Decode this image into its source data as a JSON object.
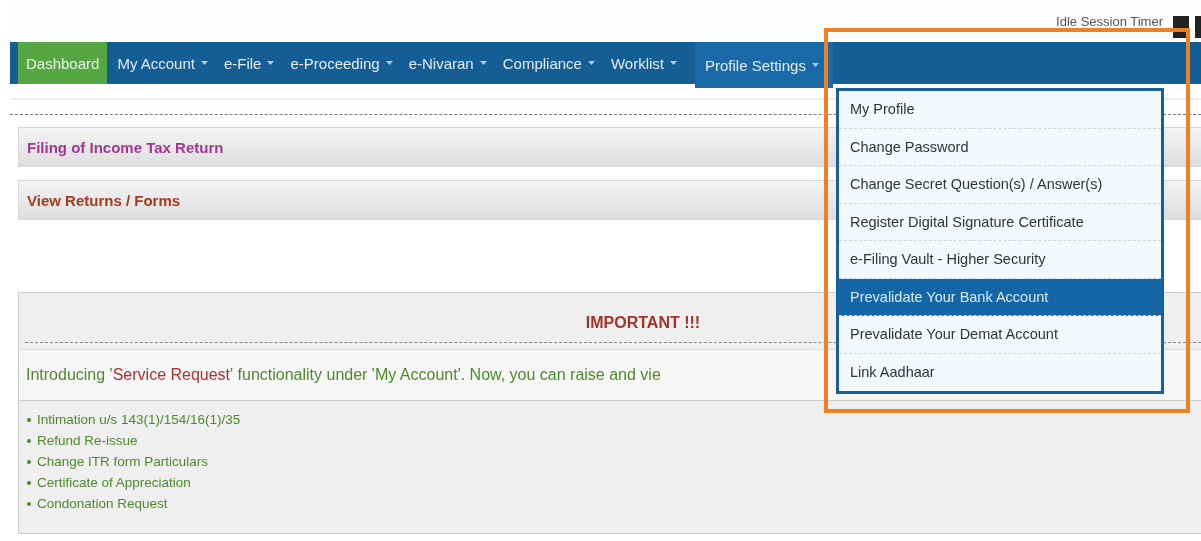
{
  "header": {
    "timer_label": "Idle Session Timer"
  },
  "nav": [
    {
      "label": "Dashboard",
      "selected": true,
      "has_menu": false,
      "open": false
    },
    {
      "label": "My Account",
      "selected": false,
      "has_menu": true,
      "open": false
    },
    {
      "label": "e-File",
      "selected": false,
      "has_menu": true,
      "open": false
    },
    {
      "label": "e-Proceeding",
      "selected": false,
      "has_menu": true,
      "open": false
    },
    {
      "label": "e-Nivaran",
      "selected": false,
      "has_menu": true,
      "open": false
    },
    {
      "label": "Compliance",
      "selected": false,
      "has_menu": true,
      "open": false
    },
    {
      "label": "Worklist",
      "selected": false,
      "has_menu": true,
      "open": false
    },
    {
      "label": "Profile Settings",
      "selected": false,
      "has_menu": true,
      "open": true
    }
  ],
  "dropdown": [
    {
      "label": "My Profile",
      "selected": false
    },
    {
      "label": "Change Password",
      "selected": false
    },
    {
      "label": "Change Secret Question(s) / Answer(s)",
      "selected": false
    },
    {
      "label": "Register Digital Signature Certificate",
      "selected": false
    },
    {
      "label": "e-Filing Vault - Higher Security",
      "selected": false
    },
    {
      "label": "Prevalidate Your Bank Account",
      "selected": true
    },
    {
      "label": "Prevalidate Your Demat Account",
      "selected": false
    },
    {
      "label": "Link Aadhaar",
      "selected": false
    }
  ],
  "sections": [
    {
      "title": "Filing of Income Tax Return",
      "color": "#a0388f"
    },
    {
      "title": "View Returns / Forms",
      "color": "#a23a22"
    }
  ],
  "notice": {
    "title": "IMPORTANT !!!",
    "text": "Introducing '*Service Request*' functionality under 'My Account'. Now, you can raise and vie",
    "items": [
      "Intimation u/s 143(1)/154/16(1)/35",
      "Refund Re-issue",
      "Change ITR form Particulars",
      "Certificate of Appreciation",
      "Condonation Request"
    ]
  }
}
